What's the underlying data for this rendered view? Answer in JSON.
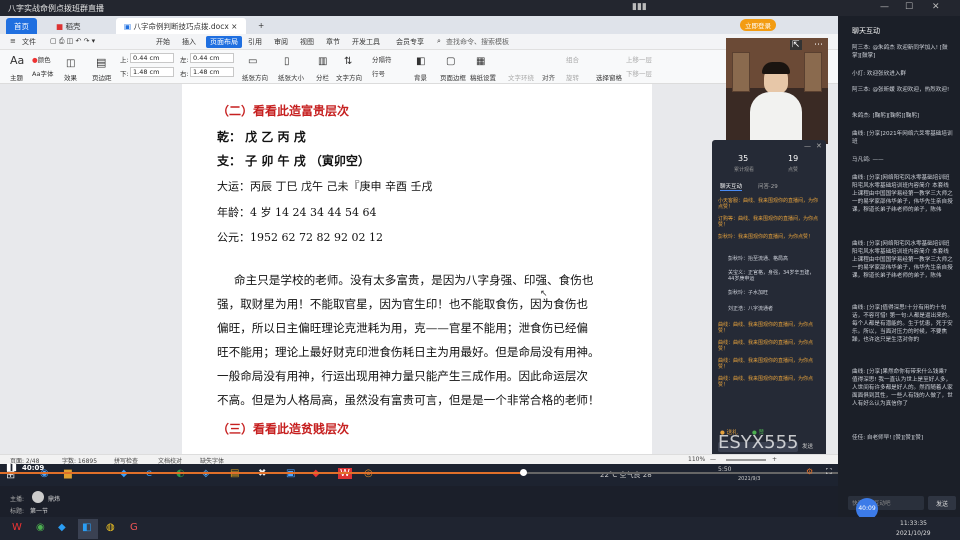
{
  "window": {
    "title": "八字实战命例点拨班群直播"
  },
  "wps": {
    "tabs": [
      {
        "label": "首页"
      },
      {
        "label": "稻壳"
      },
      {
        "label": "八字命例判断技巧点拨.docx"
      }
    ],
    "login_label": "立即登录",
    "file_menu": "文件",
    "menus": [
      "开始",
      "插入",
      "页面布局",
      "引用",
      "审阅",
      "视图",
      "章节",
      "开发工具",
      "会员专享"
    ],
    "search_placeholder": "查找命令、搜索模板",
    "toolbar": {
      "row1": [
        "主题",
        "颜色",
        "字体",
        "效果",
        "页边距",
        "上:",
        "下:",
        "左:",
        "右:",
        "纸张方向",
        "纸张大小",
        "分栏",
        "文字方向",
        "行号",
        "背景",
        "页面边框",
        "稿纸设置",
        "文字环绕",
        "对齐",
        "旋转",
        "选择窗格",
        "上移一层",
        "下移一层"
      ],
      "margin_top": "0.44 cm",
      "margin_bottom": "1.48 cm",
      "margin_left": "0.44 cm",
      "margin_right": "1.48 cm",
      "break": "分隔符",
      "combine": "组合"
    }
  },
  "document": {
    "heading2": "（二）看看此造富贵层次",
    "qian": "乾：  戊    乙    丙    戌",
    "zhi": "支：  子    卯    午    戌  （寅卯空）",
    "dayun": "大运：丙辰    丁巳    戊午    己未『庚申    辛酉    壬戌",
    "age": "年龄：4 岁      14       24       34       44       54       64",
    "year": "公元：1952      62       72       82       92       02       12",
    "para": [
      "命主只是学校的老师。没有太多富贵，是因为八字身强、印强、食伤也",
      "强，取财星为用！不能取官星，因为官生印！也不能取食伤，因为食伤也",
      "偏旺，所以日主偏旺理论克泄耗为用，克——官星不能用；泄食伤已经偏",
      "旺不能用；理论上最好财克印泄食伤耗日主为用最好。但是命局没有用神。",
      "一般命局没有用神，行运出现用神力量只能产生三成作用。因此命运层次",
      "不高。但是为人格局高，虽然没有富贵可言，但是是一个非常合格的老师！"
    ],
    "heading3": "（三）看看此造贫贱层次"
  },
  "statusbar": {
    "page": "页面: 2/48",
    "words": "字数: 16895",
    "spell": "拼写检查",
    "proof": "文档校对",
    "font_missing": "缺失字体",
    "zoom": "110%"
  },
  "overlay": {
    "watermark": "ESYX555",
    "weather": "22°C 空气良 28",
    "clock_small": "5:50",
    "date_small": "2021/9/3"
  },
  "chatpop": {
    "stat1_value": "35",
    "stat1_label": "累计观看",
    "stat2_value": "19",
    "stat2_label": "点赞",
    "tab1": "聊天互动",
    "tab2": "问答·29",
    "messages": [
      {
        "t": "小天客服：曲线、我来围观你的直播间，为你点赞！",
        "c": "o"
      },
      {
        "t": "订购等：曲线、我来围观你的直播间，为你点赞！",
        "c": "o"
      },
      {
        "t": "彭秋玲：我来围观你的直播间，为你点赞！",
        "c": "o"
      },
      {
        "t": "彭秋玲：抬至流通、格局高",
        "c": "w"
      },
      {
        "t": "关宝义：正官格，身强，34岁辛丑建，44岁庚申运",
        "c": "w"
      },
      {
        "t": "彭秋玲：子水加旺",
        "c": "w"
      },
      {
        "t": "刘正浩：八字流通者",
        "c": "w"
      },
      {
        "t": "曲线：曲线、我来围观你的直播间，为你点赞！",
        "c": "o"
      },
      {
        "t": "曲线：曲线、我来围观你的直播间，为你点赞！",
        "c": "o"
      },
      {
        "t": "曲线：曲线、我来围观你的直播间，为你点赞！",
        "c": "o"
      },
      {
        "t": "曲线：曲线、我来围观你的直播间，为你点赞！",
        "c": "o"
      }
    ],
    "btn_gift": "送礼",
    "btn_like": "赞",
    "send": "发送"
  },
  "player": {
    "time": "40:09",
    "host_label": "主播:",
    "host_name": "鼎炜",
    "title_label": "标题:",
    "title_value": "第一节"
  },
  "rightpanel": {
    "header": "聊天互动",
    "messages": [
      "阿三本: @朱鸽杰 欢迎新同学加入! [鼓掌][鼓掌]",
      "小灯: 欢迎张欣进入群",
      "阿三本: @张昕媛 欢迎欢迎，热烈欢迎!",
      "朱鸽杰: [鞠躬][鞠躬][鞠躬]",
      "曲线: [分享]2021年网络六爻零基础培训班",
      "马凡鸽: ——",
      "曲线: [分享]网络阳宅风水零基础培训班 阳宅风水零基础培训班内容简介 本套线上课程由中国国学易经第一教学三大师之一的易学家邵伟华弟子，伟华先生亲自授课，穆道长弟子纬老师的弟子，陈伟",
      "曲线: [分享]网络阳宅风水零基础培训班 阳宅风水零基础培训班内容简介 本套线上课程由中国国学易经第一教学三大师之一的易学家邵伟华弟子，伟华先生亲自授课，穆道长弟子纬老师的弟子，陈伟",
      "曲线: [分享]值得深思!十分有用的十句话，不容可惜! 第一句:人都是逼出来的。每个人都是有潜能的。生于忧患，死于安乐。所以，当面对压力的时候，不要焦躁，也许这只是生活对你的",
      "曲线: [分享]果然命你有带来什么钱乘? 值得深思! 我一直认为世上是至好人多，人世间有许多都是好人的。然而随着人家面面俱到其性，一些人有钱的人做了，世人有好么认为真信你了",
      "佳佳: 自老师早! [赞][赞][赞]"
    ],
    "input_placeholder": "快来一起互动吧",
    "send": "发送",
    "clock": "11:33:35",
    "date": "2021/10/29"
  },
  "colors": {
    "accent": "#1f6fe0",
    "heading_red": "#c62020",
    "chat_orange": "#e6a23c",
    "progress": "#e0702a"
  }
}
